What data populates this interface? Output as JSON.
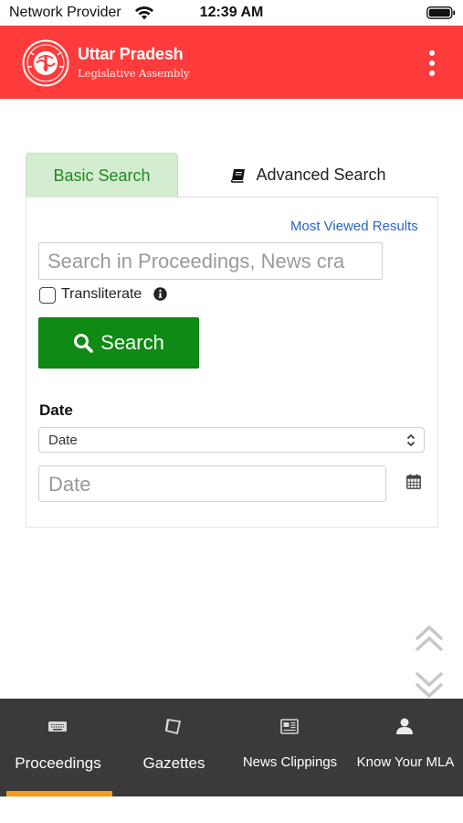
{
  "status_bar": {
    "carrier": "Network Provider",
    "time": "12:39 AM",
    "icons": [
      "wifi-icon",
      "battery-icon"
    ]
  },
  "header": {
    "title": "Uttar Pradesh",
    "subtitle": "Legislative Assembly",
    "background_color": "#ff3b3b",
    "icons": [
      "state-emblem-logo",
      "kebab-menu-icon"
    ]
  },
  "search": {
    "tabs": {
      "basic": "Basic Search",
      "advanced": "Advanced Search",
      "active": "Basic Search"
    },
    "most_viewed_link": "Most Viewed Results",
    "query_placeholder": "Search in Proceedings, News cra",
    "transliterate_label": "Transliterate",
    "transliterate_checked": false,
    "search_button": "Search",
    "date_heading": "Date",
    "date_select_value": "Date",
    "date_input_placeholder": "Date",
    "accent_color": "#0f8a14",
    "tab_active_bg": "#d4ecd0",
    "link_color": "#2a64c5"
  },
  "bottom_nav": {
    "items": [
      {
        "label": "Proceedings",
        "icon": "keyboard-icon"
      },
      {
        "label": "Gazettes",
        "icon": "gazette-icon"
      },
      {
        "label": "News Clippings",
        "icon": "newspaper-icon"
      },
      {
        "label": "Know Your MLA",
        "icon": "user-icon"
      }
    ],
    "active_index": 0,
    "background_color": "#3a3a3a",
    "indicator_color": "#f59a1b"
  }
}
